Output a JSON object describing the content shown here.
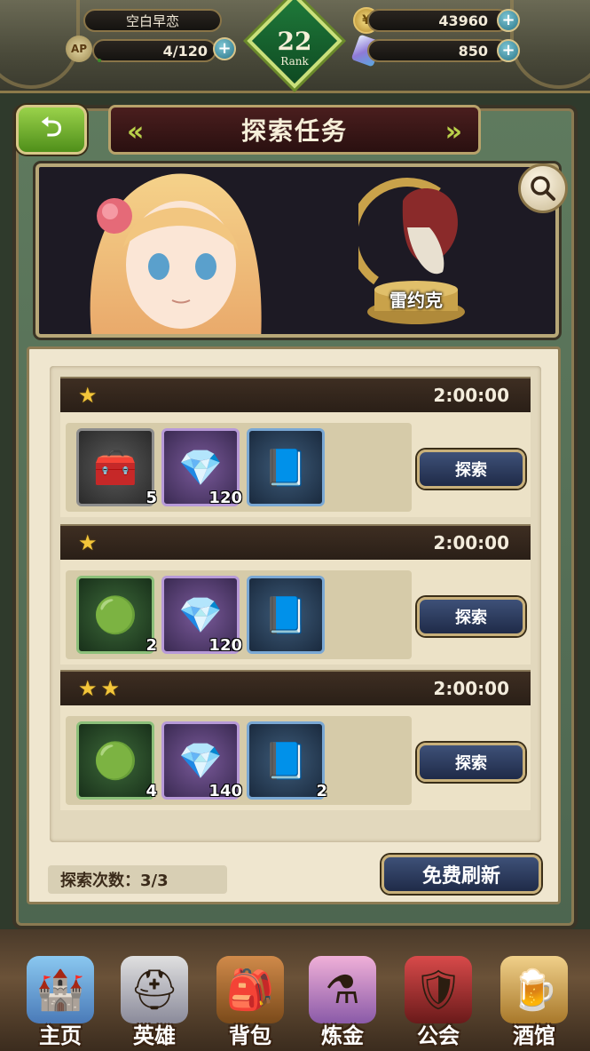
{
  "status": {
    "player_name": "空白早恋",
    "ap_label": "AP",
    "ap": "4/120",
    "ap_fill": 0.033,
    "gold": "43960",
    "gems": "850",
    "rank_number": "22",
    "rank_label": "Rank"
  },
  "header": {
    "title": "探索任务",
    "back_icon": "back-arrow-icon"
  },
  "banner": {
    "boss_name": "雷约克",
    "search_icon": "magnifier-icon"
  },
  "missions": [
    {
      "stars": 1,
      "time": "2:00:00",
      "button": "探索",
      "rewards": [
        {
          "icon": "treasure-chest-icon",
          "frame": "gray",
          "qty": "5"
        },
        {
          "icon": "gold-crystal-icon",
          "frame": "purple",
          "qty": "120"
        },
        {
          "icon": "spellbook-icon",
          "frame": "blue",
          "qty": ""
        }
      ]
    },
    {
      "stars": 1,
      "time": "2:00:00",
      "button": "探索",
      "rewards": [
        {
          "icon": "green-orb-icon",
          "frame": "green",
          "qty": "2"
        },
        {
          "icon": "gold-crystal-icon",
          "frame": "purple",
          "qty": "120"
        },
        {
          "icon": "spellbook-icon",
          "frame": "blue",
          "qty": ""
        }
      ]
    },
    {
      "stars": 2,
      "time": "2:00:00",
      "button": "探索",
      "rewards": [
        {
          "icon": "green-orb-icon",
          "frame": "green",
          "qty": "4"
        },
        {
          "icon": "gold-crystal-icon",
          "frame": "purple",
          "qty": "140"
        },
        {
          "icon": "spellbook-icon",
          "frame": "blue",
          "qty": "2"
        }
      ]
    }
  ],
  "footer": {
    "explore_count": "探索次数：3/3",
    "refresh_button": "免费刷新"
  },
  "nav": [
    {
      "label": "主页",
      "icon": "castle-icon"
    },
    {
      "label": "英雄",
      "icon": "knight-helmet-icon"
    },
    {
      "label": "背包",
      "icon": "backpack-icon"
    },
    {
      "label": "炼金",
      "icon": "potion-flasks-icon"
    },
    {
      "label": "公会",
      "icon": "guild-shield-icon"
    },
    {
      "label": "酒馆",
      "icon": "beer-mug-icon"
    }
  ],
  "colors": {
    "accent_green": "#4f8f1a",
    "button_blue": "#1f2b48",
    "star_gold": "#f3c63a",
    "title_red": "#2a1010"
  }
}
